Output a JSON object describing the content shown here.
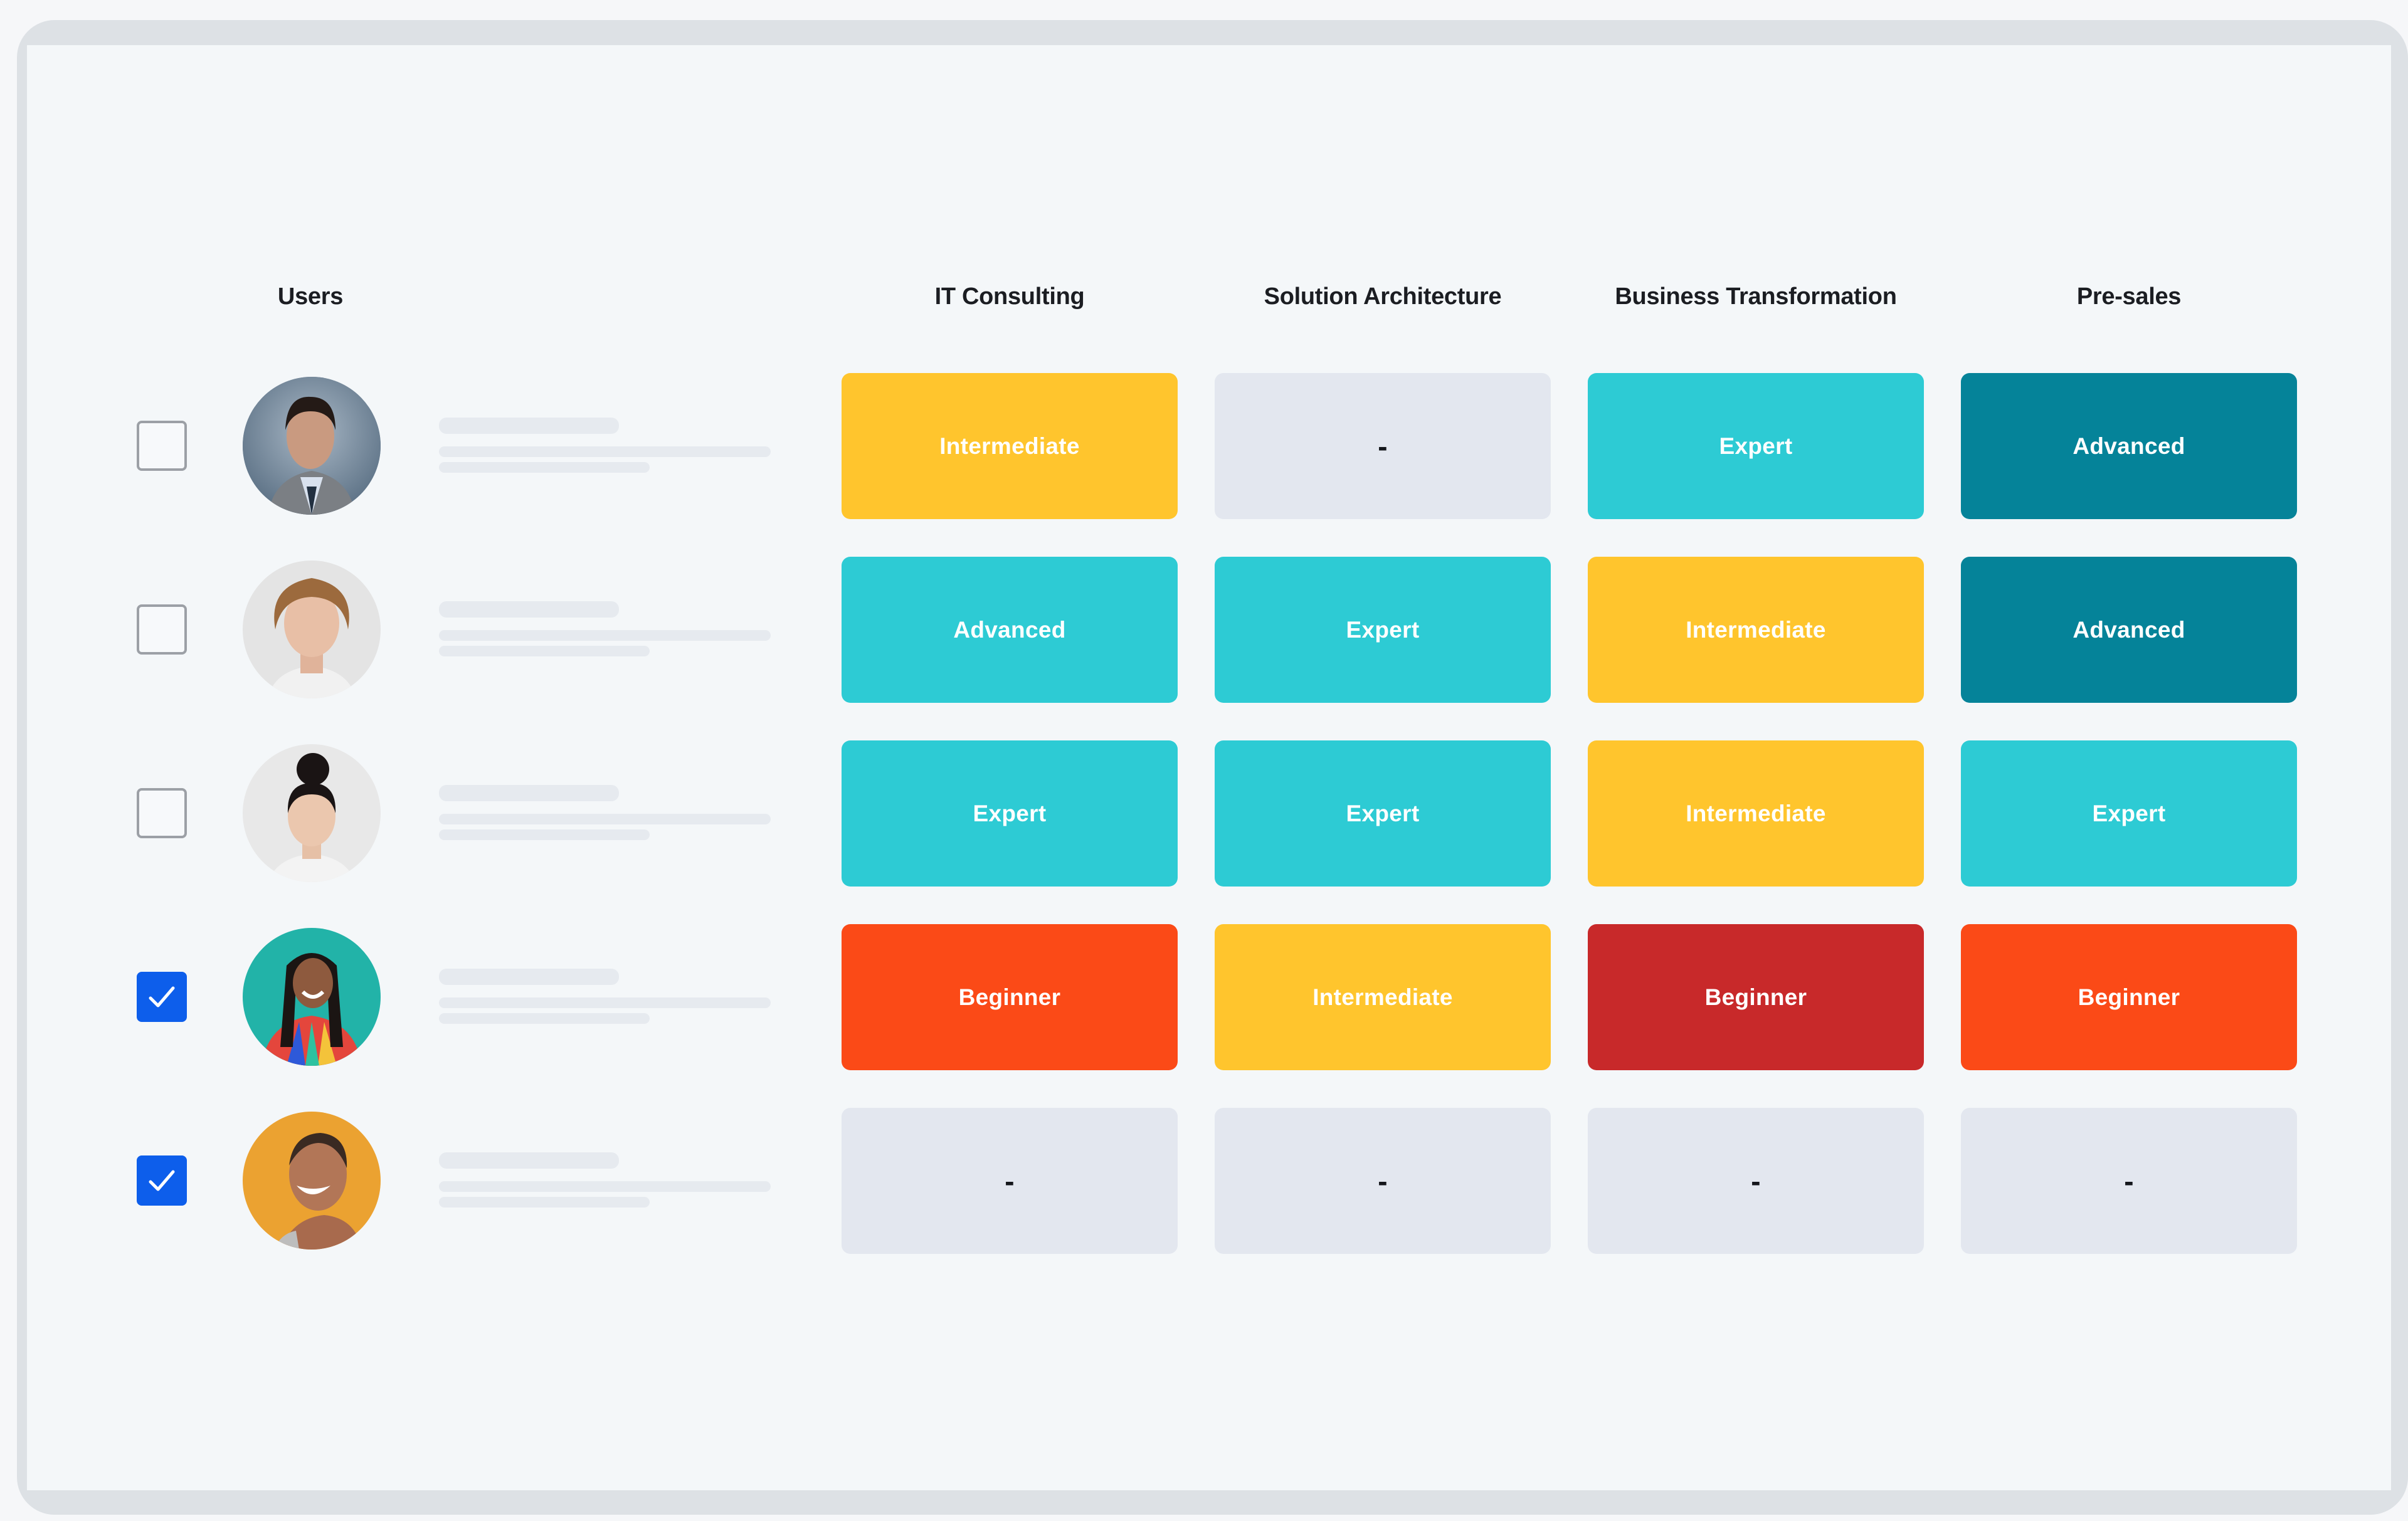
{
  "headers": {
    "users": "Users",
    "columns": [
      "IT Consulting",
      "Solution Architecture",
      "Business Transformation",
      "Pre-sales"
    ]
  },
  "level_colors": {
    "Beginner": "#FB4A17",
    "Beginner-dark": "#C8292A",
    "Intermediate": "#FFC52D",
    "Advanced": "#058399",
    "Expert": "#2DCBD4",
    "empty": "#E3E7EF"
  },
  "checkbox_color": "#0D5EEB",
  "users": [
    {
      "avatar": "man-dark-hair-gray-jacket",
      "checked": false,
      "skills": [
        {
          "label": "Intermediate",
          "color": "#FFC52D"
        },
        {
          "label": "-",
          "color": "#E3E7EF"
        },
        {
          "label": "Expert",
          "color": "#2DCBD4"
        },
        {
          "label": "Advanced",
          "color": "#058399"
        }
      ]
    },
    {
      "avatar": "young-man-curly-hair",
      "checked": false,
      "skills": [
        {
          "label": "Advanced",
          "color": "#2DCBD4"
        },
        {
          "label": "Expert",
          "color": "#2DCBD4"
        },
        {
          "label": "Intermediate",
          "color": "#FFC52D"
        },
        {
          "label": "Advanced",
          "color": "#058399"
        }
      ]
    },
    {
      "avatar": "woman-hair-bun",
      "checked": false,
      "skills": [
        {
          "label": "Expert",
          "color": "#2DCBD4"
        },
        {
          "label": "Expert",
          "color": "#2DCBD4"
        },
        {
          "label": "Intermediate",
          "color": "#FFC52D"
        },
        {
          "label": "Expert",
          "color": "#2DCBD4"
        }
      ]
    },
    {
      "avatar": "woman-braids-teal-background",
      "checked": true,
      "skills": [
        {
          "label": "Beginner",
          "color": "#FB4A17"
        },
        {
          "label": "Intermediate",
          "color": "#FFC52D"
        },
        {
          "label": "Beginner",
          "color": "#C8292A"
        },
        {
          "label": "Beginner",
          "color": "#FB4A17"
        }
      ]
    },
    {
      "avatar": "woman-laughing-orange-background",
      "checked": true,
      "skills": [
        {
          "label": "-",
          "color": "#E3E7EF"
        },
        {
          "label": "-",
          "color": "#E3E7EF"
        },
        {
          "label": "-",
          "color": "#E3E7EF"
        },
        {
          "label": "-",
          "color": "#E3E7EF"
        }
      ]
    }
  ]
}
